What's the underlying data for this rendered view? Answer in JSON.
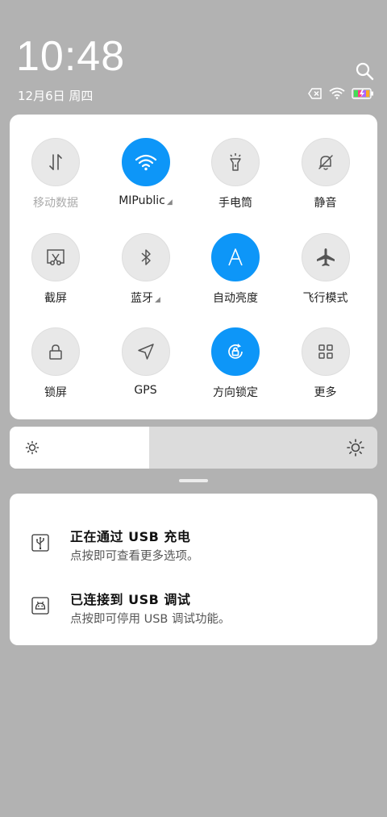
{
  "status_bar": {
    "time": "10:48",
    "date": "12月6日 周四",
    "icons": [
      "search-icon",
      "sim-none-icon",
      "wifi-icon",
      "battery-charging-icon"
    ]
  },
  "quick_settings": {
    "tiles": [
      {
        "id": "mobile-data",
        "label": "移动数据",
        "icon": "mobile-data-icon",
        "active": false,
        "disabled": true
      },
      {
        "id": "wifi",
        "label": "MIPublic",
        "icon": "wifi-icon",
        "active": true,
        "has_menu": true
      },
      {
        "id": "flashlight",
        "label": "手电筒",
        "icon": "flashlight-icon",
        "active": false
      },
      {
        "id": "silent",
        "label": "静音",
        "icon": "bell-off-icon",
        "active": false
      },
      {
        "id": "screenshot",
        "label": "截屏",
        "icon": "screenshot-icon",
        "active": false
      },
      {
        "id": "bluetooth",
        "label": "蓝牙",
        "icon": "bluetooth-icon",
        "active": false,
        "has_menu": true
      },
      {
        "id": "auto-brightness",
        "label": "自动亮度",
        "icon": "auto-brightness-icon",
        "active": true
      },
      {
        "id": "airplane",
        "label": "飞行模式",
        "icon": "airplane-icon",
        "active": false
      },
      {
        "id": "lock-screen",
        "label": "锁屏",
        "icon": "lock-icon",
        "active": false
      },
      {
        "id": "gps",
        "label": "GPS",
        "icon": "gps-icon",
        "active": false
      },
      {
        "id": "rotation-lock",
        "label": "方向锁定",
        "icon": "rotation-lock-icon",
        "active": true
      },
      {
        "id": "more",
        "label": "更多",
        "icon": "grid-icon",
        "active": false
      }
    ]
  },
  "brightness": {
    "level": 0.38,
    "icon_low": "sun-small-icon",
    "icon_high": "sun-large-icon"
  },
  "notifications": [
    {
      "title": "正在通过 USB 充电",
      "subtitle": "点按即可查看更多选项。",
      "icon": "usb-icon"
    },
    {
      "title": "已连接到 USB 调试",
      "subtitle": "点按即可停用 USB 调试功能。",
      "icon": "android-debug-icon"
    }
  ],
  "colors": {
    "accent": "#0d96f8",
    "background": "#b2b2b2",
    "tile_off": "#e8e8e8"
  }
}
